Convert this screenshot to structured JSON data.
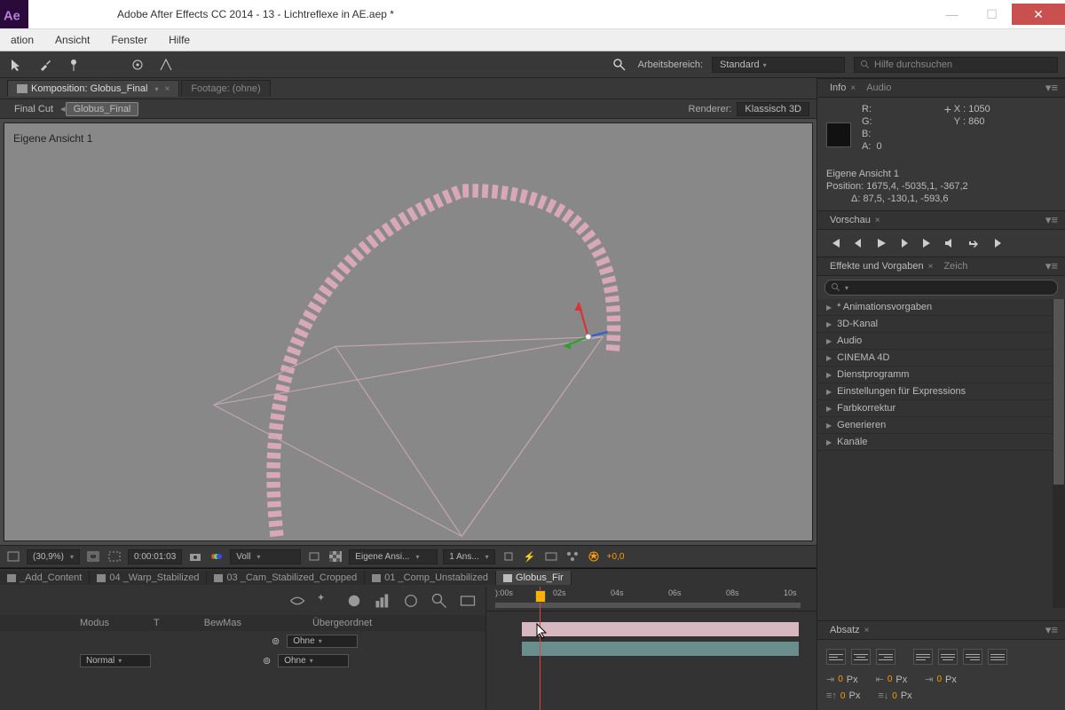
{
  "titlebar": {
    "text": "Adobe After Effects CC 2014 - 13 - Lichtreflexe in AE.aep *"
  },
  "menu": {
    "items": [
      "ation",
      "Ansicht",
      "Fenster",
      "Hilfe"
    ]
  },
  "toolbar": {
    "workspace_label": "Arbeitsbereich:",
    "workspace_value": "Standard",
    "search_placeholder": "Hilfe durchsuchen"
  },
  "composition_tabs": {
    "active": "Komposition: Globus_Final",
    "inactive": "Footage: (ohne)"
  },
  "breadcrumb": {
    "a": "Final Cut",
    "b": "Globus_Final",
    "renderer_label": "Renderer:",
    "renderer_value": "Klassisch 3D"
  },
  "viewport": {
    "label": "Eigene Ansicht 1"
  },
  "viewfooter": {
    "zoom": "(30,9%)",
    "time": "0:00:01:03",
    "res": "Voll",
    "view": "Eigene Ansi...",
    "views": "1 Ans...",
    "exposure": "+0,0"
  },
  "info": {
    "tab1": "Info",
    "tab2": "Audio",
    "r": "R:",
    "g": "G:",
    "b": "B:",
    "a_label": "A:",
    "a_val": "0",
    "x_label": "X :",
    "x_val": "1050",
    "y_label": "Y :",
    "y_val": "860",
    "cam": "Eigene Ansicht 1",
    "pos": "Position: 1675,4, -5035,1, -367,2",
    "delta": "Δ: 87,5, -130,1, -593,6"
  },
  "preview": {
    "tab": "Vorschau"
  },
  "effects": {
    "tab": "Effekte und Vorgaben",
    "tab2": "Zeich",
    "items": [
      "* Animationsvorgaben",
      "3D-Kanal",
      "Audio",
      "CINEMA 4D",
      "Dienstprogramm",
      "Einstellungen für Expressions",
      "Farbkorrektur",
      "Generieren",
      "Kanäle"
    ]
  },
  "absatz": {
    "tab": "Absatz",
    "px": "Px",
    "zero": "0"
  },
  "timeline": {
    "tabs": [
      "_Add_Content",
      "04 _Warp_Stabilized",
      "03 _Cam_Stabilized_Cropped",
      "01 _Comp_Unstabilized",
      "Globus_Fir"
    ],
    "col_modus": "Modus",
    "col_t": "T",
    "col_bewmas": "BewMas",
    "col_parent": "Übergeordnet",
    "ohne": "Ohne",
    "normal": "Normal",
    "ticks": [
      "):00s",
      "02s",
      "04s",
      "06s",
      "08s",
      "10s"
    ]
  }
}
